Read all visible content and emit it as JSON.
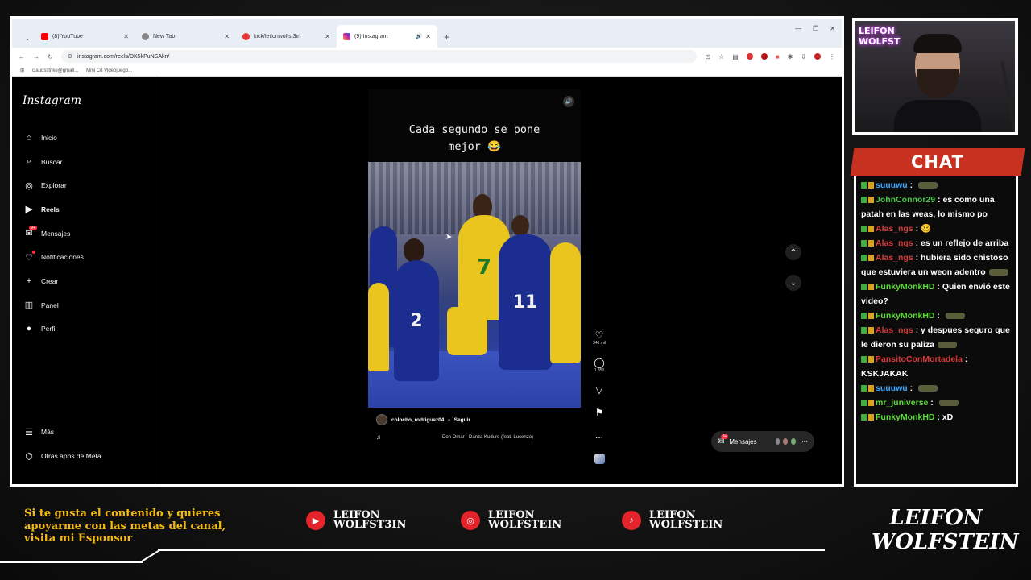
{
  "browser": {
    "tabs": [
      {
        "label": "(8) YouTube",
        "favicon_color": "#ff0000",
        "active": false
      },
      {
        "label": "New Tab",
        "favicon_color": "#777777",
        "active": false
      },
      {
        "label": "kick/leifonwolfst3in",
        "favicon_color": "#e33",
        "active": false
      },
      {
        "label": "(9) Instagram",
        "favicon_color": "#d6249f",
        "active": true
      }
    ],
    "new_tab": "+",
    "url": "instagram.com/reels/DK5kPuNSAkn/",
    "bookmarks": [
      "claudsstrike@gmail...",
      "Mini Cd Videojuego..."
    ]
  },
  "instagram": {
    "logo": "Instagram",
    "nav": [
      {
        "label": "Inicio",
        "icon": "home-icon",
        "glyph": "⌂"
      },
      {
        "label": "Buscar",
        "icon": "search-icon",
        "glyph": "⌕"
      },
      {
        "label": "Explorar",
        "icon": "compass-icon",
        "glyph": "◎"
      },
      {
        "label": "Reels",
        "icon": "reels-icon",
        "glyph": "▶"
      },
      {
        "label": "Mensajes",
        "icon": "messenger-icon",
        "glyph": "✉",
        "badge": "9+"
      },
      {
        "label": "Notificaciones",
        "icon": "heart-icon",
        "glyph": "♡"
      },
      {
        "label": "Crear",
        "icon": "plus-icon",
        "glyph": "+"
      },
      {
        "label": "Panel",
        "icon": "dashboard-icon",
        "glyph": "▥"
      },
      {
        "label": "Perfil",
        "icon": "profile-avatar-icon",
        "glyph": "●"
      }
    ],
    "more": "Más",
    "meta_apps": "Otras apps de Meta",
    "reel": {
      "caption_line1": "Cada segundo se pone",
      "caption_line2": "mejor 😂",
      "author": "colocho_rodriguez04",
      "separator": "•",
      "follow": "Seguir",
      "song": "Don Omar - Danza Kuduro (feat. Lucenzo)",
      "jersey_numbers": [
        "7",
        "11",
        "2"
      ],
      "likes": "340 mil",
      "comments": "1.850",
      "more": "..."
    },
    "messages_pill": "Mensajes"
  },
  "chat": {
    "header": "CHAT",
    "messages": [
      {
        "user": "suuuwu",
        "color": "blue",
        "text": "",
        "emote": true
      },
      {
        "user": "JohnConnor29",
        "color": "green",
        "text": "es como una patah en las weas, lo mismo po",
        "emote": false
      },
      {
        "user": "Alas_ngs",
        "color": "red",
        "text": "🥴",
        "emote": false
      },
      {
        "user": "Alas_ngs",
        "color": "red",
        "text": "es un reflejo de arriba",
        "emote": false
      },
      {
        "user": "Alas_ngs",
        "color": "red",
        "text": "hubiera sido chistoso que estuviera un weon adentro",
        "emote": true
      },
      {
        "user": "FunkyMonkHD",
        "color": "lime",
        "text": "Quien envió este video?",
        "emote": false
      },
      {
        "user": "FunkyMonkHD",
        "color": "lime",
        "text": "",
        "emote": true
      },
      {
        "user": "Alas_ngs",
        "color": "red",
        "text": "y despues seguro que le dieron su paliza",
        "emote": true
      },
      {
        "user": "PansitoConMortadela",
        "color": "red",
        "text": "KSKJAKAK",
        "emote": false
      },
      {
        "user": "suuuwu",
        "color": "blue",
        "text": "",
        "emote": true
      },
      {
        "user": "mr_juniverse",
        "color": "lime",
        "text": "",
        "emote": true
      },
      {
        "user": "FunkyMonkHD",
        "color": "lime",
        "text": "xD",
        "emote": false
      }
    ]
  },
  "webcam": {
    "neon_line1": "LEIFON",
    "neon_line2": "WOLFST"
  },
  "overlay": {
    "sponsor_text": "Si te gusta el contenido y quieres apoyarme con las metas del canal, visita mi Esponsor",
    "youtube": {
      "line1": "LEIFON",
      "line2": "WOLFST3IN"
    },
    "instagram": {
      "line1": "LEIFON",
      "line2": "WOLFSTEIN"
    },
    "tiktok": {
      "line1": "LEIFON",
      "line2": "WOLFSTEIN"
    },
    "logo_line1": "LEIFON",
    "logo_line2": "WOLFSTEIN"
  },
  "colors": {
    "accent_red": "#c8311f",
    "sponsor_gold": "#f2b90f",
    "ig_badge": "#ff3040"
  }
}
